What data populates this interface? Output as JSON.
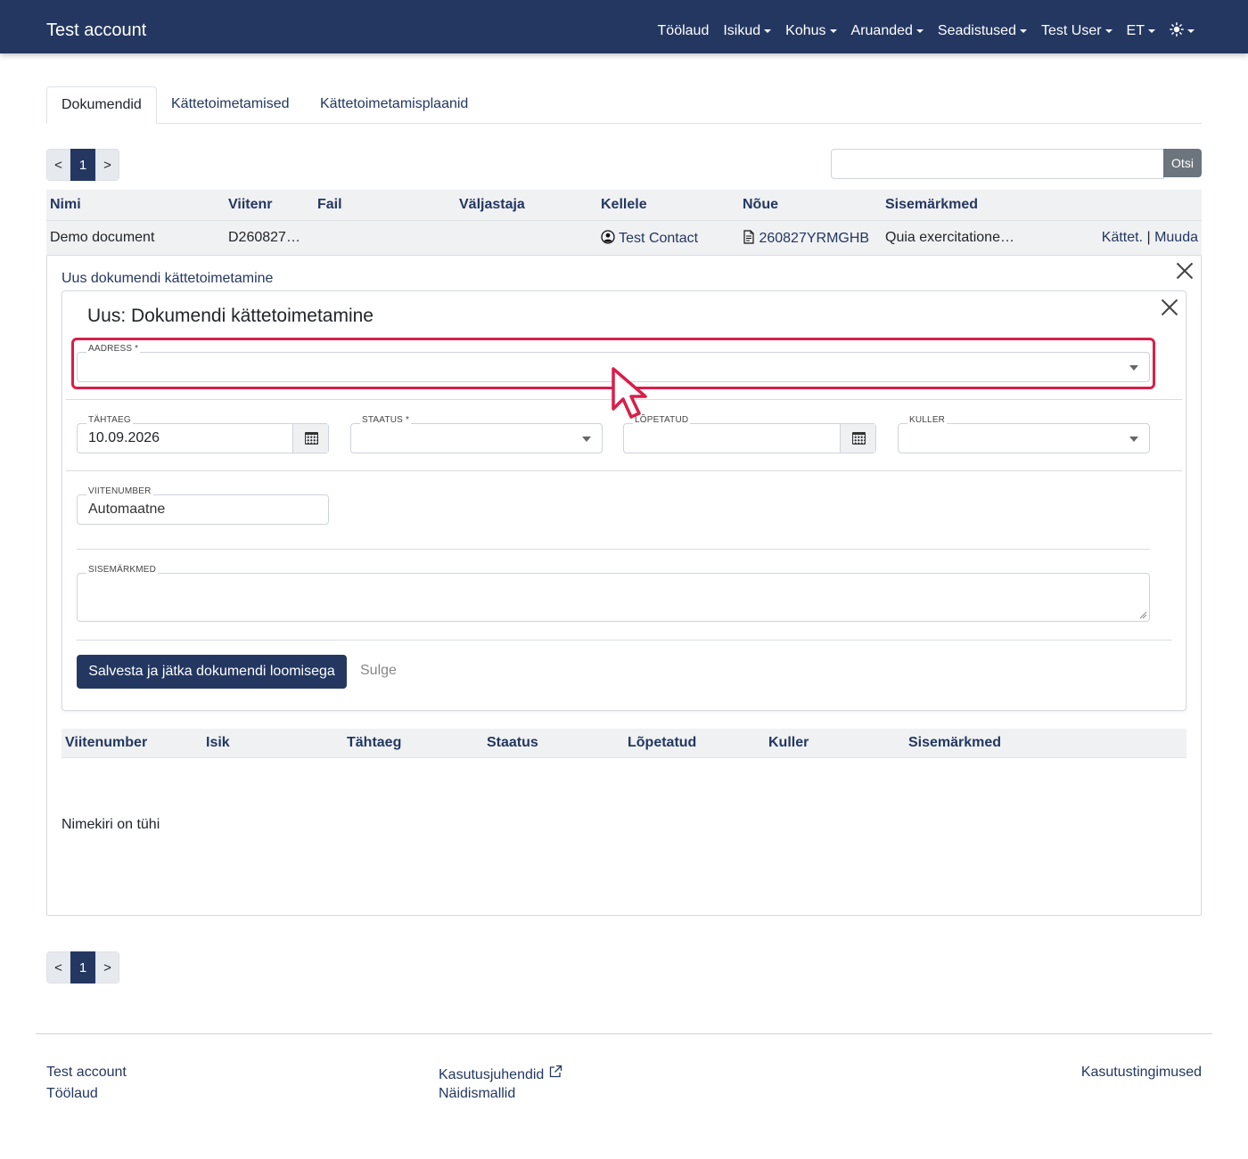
{
  "navbar": {
    "brand": "Test account",
    "items": [
      "Töölaud",
      "Isikud",
      "Kohus",
      "Aruanded",
      "Seadistused",
      "Test User",
      "ET"
    ],
    "theme_icon": "sun-icon",
    "bg_color": "#233761"
  },
  "tabs": [
    "Dokumendid",
    "Kättetoimetamised",
    "Kättetoimetamisplaanid"
  ],
  "pager": {
    "prev": "<",
    "current": "1",
    "next": ">"
  },
  "search": {
    "button": "Otsi",
    "value": ""
  },
  "table": {
    "headers": [
      "Nimi",
      "Viitenr",
      "Fail",
      "Väljastaja",
      "Kellele",
      "Nõue",
      "Sisemärkmed"
    ],
    "row": {
      "name": "Demo document",
      "ref": "D260827…",
      "file": "",
      "issuer": "",
      "recipient": "Test Contact",
      "claim": "260827YRMGHB",
      "notes": "Quia exercitatione…",
      "action_deliver": "Kättet.",
      "separator": "|",
      "action_edit": "Muuda"
    }
  },
  "panel": {
    "link": "Uus dokumendi kättetoimetamine",
    "form": {
      "title": "Uus: Dokumendi kättetoimetamine",
      "address_label": "AADRESS *",
      "address_value": "",
      "deadline_label": "TÄHTAEG",
      "deadline_value": "10.09.2026",
      "status_label": "STAATUS *",
      "status_value": "",
      "finished_label": "LÕPETATUD",
      "finished_value": "",
      "courier_label": "KULLER",
      "courier_value": "",
      "ref_label": "VIITENUMBER",
      "ref_value": "Automaatne",
      "notes_label": "SISEMÄRKMED",
      "notes_value": "",
      "save_button": "Salvesta ja jätka dokumendi loomisega",
      "close_button": "Sulge"
    },
    "sub_table": {
      "headers": [
        "Viitenumber",
        "Isik",
        "Tähtaeg",
        "Staatus",
        "Lõpetatud",
        "Kuller",
        "Sisemärkmed"
      ],
      "empty": "Nimekiri on tühi"
    }
  },
  "footer": {
    "col1": [
      "Test account",
      "Töölaud"
    ],
    "col2": [
      "Kasutusjuhendid",
      "Näidismallid"
    ],
    "col3": [
      "Kasutustingimused"
    ]
  },
  "colors": {
    "highlight": "#d81e4b",
    "primary": "#233761"
  }
}
